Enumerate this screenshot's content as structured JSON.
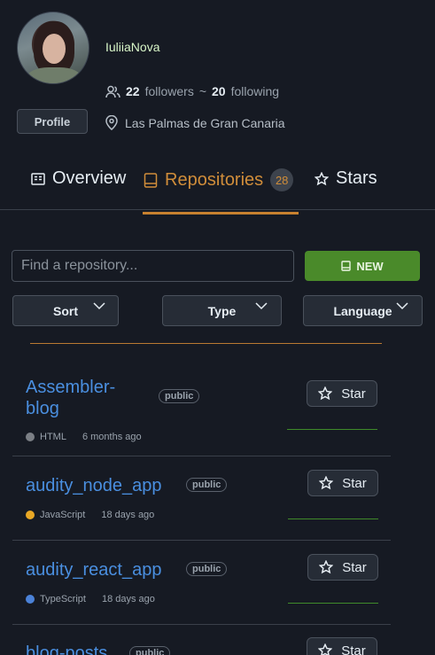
{
  "profile": {
    "username": "IuliiaNova",
    "followers_count": "22",
    "followers_label": "followers",
    "separator": "~",
    "following_count": "20",
    "following_label": "following",
    "location": "Las Palmas de Gran Canaria",
    "profile_button": "Profile"
  },
  "tabs": {
    "overview": "Overview",
    "repositories": "Repositories",
    "repositories_count": "28",
    "stars": "Stars"
  },
  "search": {
    "placeholder": "Find a repository..."
  },
  "new_button": "NEW",
  "filters": {
    "sort": "Sort",
    "type": "Type",
    "language": "Language"
  },
  "repos": [
    {
      "name": "Assembler-blog",
      "name_line1": "Assembler-",
      "name_line2": "blog",
      "visibility": "public",
      "language": "HTML",
      "language_color": "#7b7f85",
      "updated": "6 months ago",
      "star_label": "Star"
    },
    {
      "name": "audity_node_app",
      "visibility": "public",
      "language": "JavaScript",
      "language_color": "#e9a825",
      "updated": "18 days ago",
      "star_label": "Star"
    },
    {
      "name": "audity_react_app",
      "visibility": "public",
      "language": "TypeScript",
      "language_color": "#4b82d8",
      "updated": "18 days ago",
      "star_label": "Star"
    },
    {
      "name": "blog-posts",
      "visibility": "public",
      "star_label": "Star"
    }
  ],
  "colors": {
    "accent": "#c7812f",
    "new_button": "#4a8a2a",
    "link": "#4a8fe0"
  }
}
